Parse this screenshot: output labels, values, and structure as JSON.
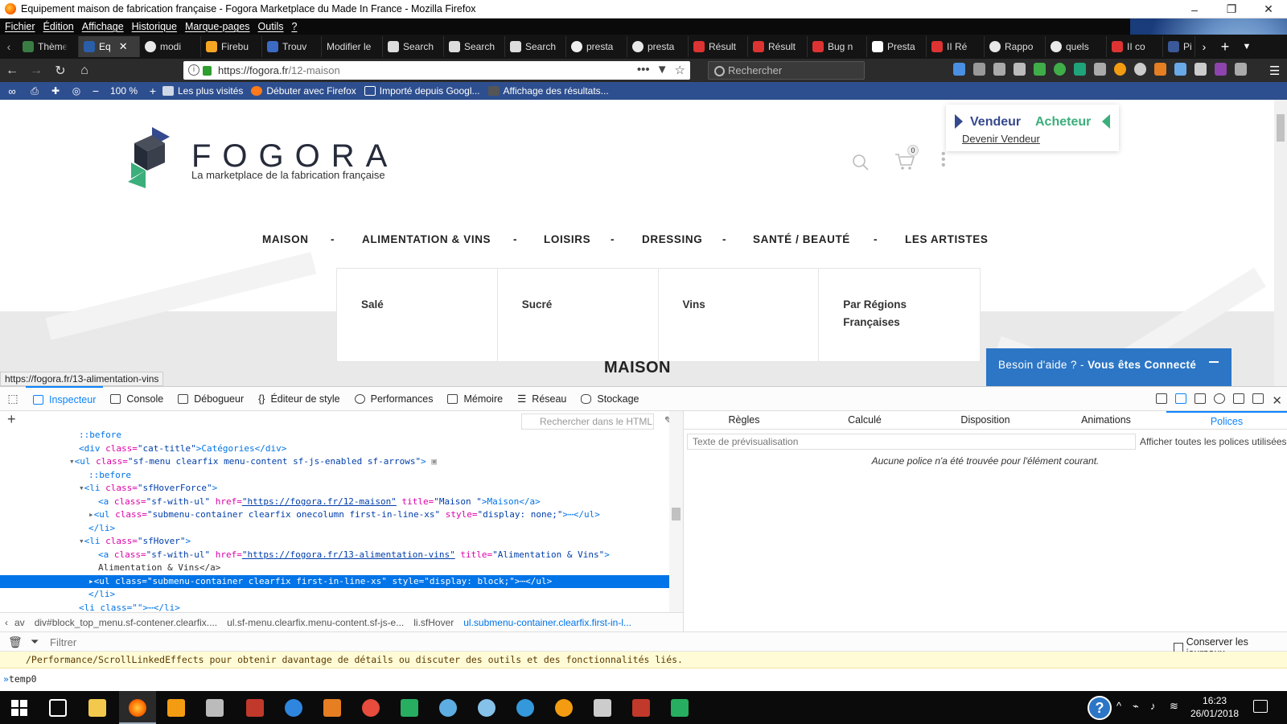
{
  "window": {
    "title": "Equipement maison de fabrication française - Fogora Marketplace du Made In France - Mozilla Firefox",
    "controls": [
      "–",
      "❐",
      "✕"
    ]
  },
  "menubar": [
    "Fichier",
    "Édition",
    "Affichage",
    "Historique",
    "Marque-pages",
    "Outils",
    "?"
  ],
  "tabs": [
    {
      "label": "Thème",
      "color": "#3a7d44"
    },
    {
      "label": "Eq",
      "color": "#2a5ea8",
      "active": true
    },
    {
      "label": "modi",
      "color": "#e8e8e8"
    },
    {
      "label": "Firebu",
      "color": "#f5a623"
    },
    {
      "label": "Trouv",
      "color": "#3b6bc4"
    },
    {
      "label": "Modifier le",
      "color": "#555"
    },
    {
      "label": "Search",
      "color": "#ddd"
    },
    {
      "label": "Search",
      "color": "#ddd"
    },
    {
      "label": "Search",
      "color": "#ddd"
    },
    {
      "label": "presta",
      "color": "#eee"
    },
    {
      "label": "presta",
      "color": "#e8e8e8"
    },
    {
      "label": "Résult",
      "color": "#d33"
    },
    {
      "label": "Résult",
      "color": "#d33"
    },
    {
      "label": "Bug n",
      "color": "#d33"
    },
    {
      "label": "Presta",
      "color": "#fff"
    },
    {
      "label": "II Ré",
      "color": "#d33"
    },
    {
      "label": "Rappo",
      "color": "#e8e8e8"
    },
    {
      "label": "quels",
      "color": "#e8e8e8"
    },
    {
      "label": "II co",
      "color": "#d33"
    },
    {
      "label": "Pi",
      "color": "#3b5998"
    }
  ],
  "navbar": {
    "url_host": "https://fogora.fr",
    "url_path": "/12-maison",
    "search_placeholder": "Rechercher"
  },
  "bookmarks": {
    "zoom": "100 %",
    "items": [
      "Les plus visités",
      "Débuter avec Firefox",
      "Importé depuis Googl...",
      "Affichage des résultats..."
    ]
  },
  "site": {
    "brand": "FOGORA",
    "tagline": "La marketplace de la fabrication française",
    "cart_count": "0",
    "seller_box": {
      "vendeur": "Vendeur",
      "acheteur": "Acheteur",
      "devenir": "Devenir Vendeur"
    },
    "nav": [
      "MAISON",
      "ALIMENTATION & VINS",
      "LOISIRS",
      "DRESSING",
      "SANTÉ / BEAUTÉ",
      "LES ARTISTES"
    ],
    "nav_separator": "-",
    "submenu": [
      "Salé",
      "Sucré",
      "Vins",
      "Par Régions\nFrançaises"
    ],
    "help_text": "Besoin d'aide ? - ",
    "help_bold": "Vous êtes Connecté",
    "page_title": "MAISON",
    "status_url": "https://fogora.fr/13-alimentation-vins"
  },
  "devtools": {
    "tabs": [
      "Inspecteur",
      "Console",
      "Débogueur",
      "Éditeur de style",
      "Performances",
      "Mémoire",
      "Réseau",
      "Stockage"
    ],
    "markup_search_placeholder": "Rechercher dans le HTML",
    "markup": {
      "l1": "::before",
      "l2_tag_open": "<div ",
      "l2_attr": "class=",
      "l2_val": "\"cat-title\"",
      "l2_text": ">Catégories</div>",
      "l3_tag": "<ul ",
      "l3_attr": "class=",
      "l3_val": "\"sf-menu clearfix menu-content sf-js-enabled sf-arrows\"",
      "l3_end": ">",
      "l4": "::before",
      "l5_tag": "<li ",
      "l5_attr": "class=",
      "l5_val": "\"sfHoverForce\"",
      "l5_end": ">",
      "l6_tag": "<a ",
      "l6_a1": "class=",
      "l6_v1": "\"sf-with-ul\"",
      "l6_a2": " href=",
      "l6_v2": "\"https://fogora.fr/12-maison\"",
      "l6_a3": " title=",
      "l6_v3": "\"Maison \"",
      "l6_end": ">Maison</a>",
      "l7_tag": "<ul ",
      "l7_a1": "class=",
      "l7_v1": "\"submenu-container clearfix onecolumn first-in-line-xs\"",
      "l7_a2": " style=",
      "l7_v2": "\"display: none;\"",
      "l7_end": ">⋯</ul>",
      "l8": "</li>",
      "l9_tag": "<li ",
      "l9_attr": "class=",
      "l9_val": "\"sfHover\"",
      "l9_end": ">",
      "l10_tag": "<a ",
      "l10_a1": "class=",
      "l10_v1": "\"sf-with-ul\"",
      "l10_a2": " href=",
      "l10_v2": "\"https://fogora.fr/13-alimentation-vins\"",
      "l10_a3": " title=",
      "l10_v3": "\"Alimentation & Vins\"",
      "l10_end": ">",
      "l11": "Alimentation & Vins</a>",
      "l12_tag": "<ul ",
      "l12_a1": "class=",
      "l12_v1": "\"submenu-container clearfix first-in-line-xs\"",
      "l12_a2": " style=",
      "l12_v2": "\"display: block;\"",
      "l12_end": ">⋯</ul>",
      "l13": "</li>",
      "l14": "<li class=\"\">⋯</li>"
    },
    "breadcrumbs": [
      "av",
      "div#block_top_menu.sf-contener.clearfix....",
      "ul.sf-menu.clearfix.menu-content.sf-js-e...",
      "li.sfHover",
      "ul.submenu-container.clearfix.first-in-l..."
    ],
    "side_tabs": [
      "Règles",
      "Calculé",
      "Disposition",
      "Animations",
      "Polices"
    ],
    "preview_placeholder": "Texte de prévisualisation",
    "show_all_fonts": "Afficher toutes les polices utilisées",
    "no_font": "Aucune police n'a été trouvée pour l'élément courant.",
    "console_filter": "Filtrer",
    "keep_logs": "Conserver les journaux",
    "console_warning": "/Performance/ScrollLinkedEffects pour obtenir davantage de détails ou discuter des outils et des fonctionnalités liés.",
    "console_input": "temp0"
  },
  "taskbar": {
    "time": "16:23",
    "date": "26/01/2018"
  },
  "colors": {
    "brand_blue": "#35498e",
    "brand_green": "#3bae7b",
    "help_blue": "#2c76c5",
    "devtools_accent": "#0a84ff"
  }
}
